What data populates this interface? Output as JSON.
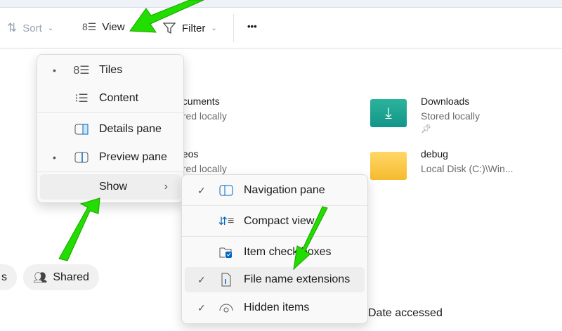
{
  "toolbar": {
    "sort": "Sort",
    "view": "View",
    "filter": "Filter",
    "more": "•••"
  },
  "tiles": [
    {
      "name": "ocuments",
      "sub": "ored locally"
    },
    {
      "name": "deos",
      "sub": "ored locally"
    },
    {
      "name": "Downloads",
      "sub": "Stored locally"
    },
    {
      "name": "debug",
      "sub": "Local Disk (C:)\\Win..."
    }
  ],
  "view_menu": {
    "items": [
      {
        "label": "Tiles",
        "mark": "•"
      },
      {
        "label": "Content",
        "mark": ""
      },
      {
        "label": "Details pane",
        "mark": ""
      },
      {
        "label": "Preview pane",
        "mark": "•"
      },
      {
        "label": "Show",
        "mark": "",
        "arrow": "›"
      }
    ]
  },
  "show_menu": {
    "items": [
      {
        "label": "Navigation pane",
        "mark": "✓"
      },
      {
        "label": "Compact view",
        "mark": ""
      },
      {
        "label": "Item check boxes",
        "mark": ""
      },
      {
        "label": "File name extensions",
        "mark": "✓"
      },
      {
        "label": "Hidden items",
        "mark": "✓"
      }
    ]
  },
  "chips": {
    "partial": "s",
    "shared": "Shared"
  },
  "column": {
    "date_accessed": "Date accessed"
  },
  "colors": {
    "accent": "#0067c0",
    "arrow": "#22dd00"
  }
}
